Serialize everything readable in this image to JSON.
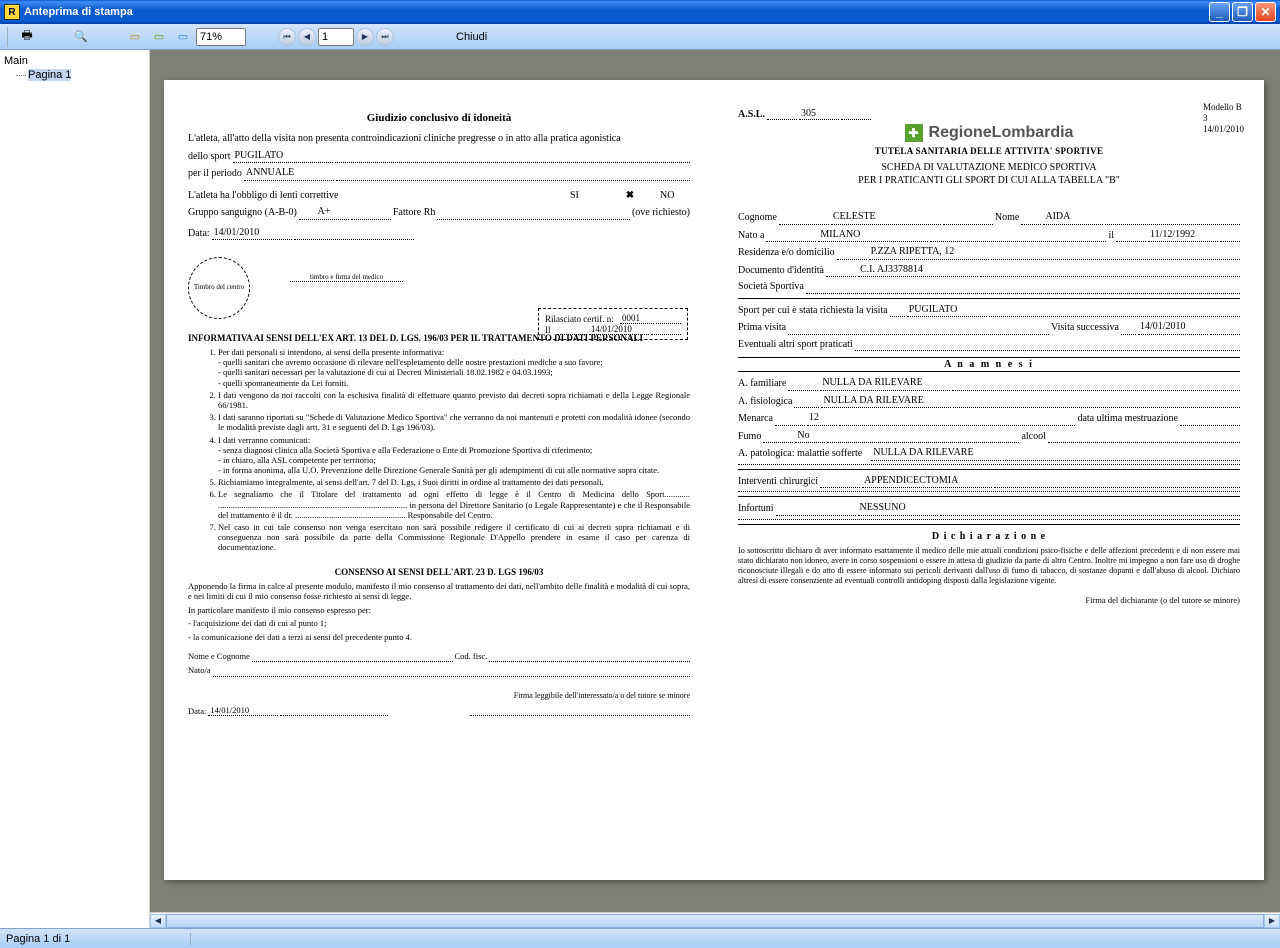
{
  "window": {
    "title": "Anteprima di stampa"
  },
  "toolbar": {
    "zoom": "71%",
    "page_current": "1",
    "close_label": "Chiudi"
  },
  "tree": {
    "root": "Main",
    "page": "Pagina 1"
  },
  "statusbar": {
    "page": "Pagina 1 di 1"
  },
  "left": {
    "title": "Giudizio conclusivo di idoneità",
    "intro": "L'atleta, all'atto della visita non presenta controindicazioni cliniche pregresse o in atto alla pratica agonistica",
    "sport_lbl": "dello sport",
    "sport": "PUGILATO",
    "periodo_lbl": "per il periodo",
    "periodo": "ANNUALE",
    "lenti": "L'atleta ha l'obbligo di lenti correttive",
    "si": "SI",
    "no": "NO",
    "gruppo_lbl": "Gruppo sanguigno (A-B-0)",
    "gruppo": "A+",
    "rh_lbl": "Fattore Rh",
    "rich": "(ove richiesto)",
    "data_lbl": "Data:",
    "data": "14/01/2010",
    "timbro": "Timbro del centro",
    "firmamed": "timbro e firma del medico",
    "cert_num_lbl": "Rilasciato certif. n:",
    "cert_num": "0001",
    "cert_il_lbl": "Il",
    "cert_il": "14/01/2010",
    "info_title": "INFORMATIVA AI SENSI DELL'EX ART. 13 DEL D. LGS. 196/03 PER IL TRATTAMENTO DI DATI PERSONALI",
    "p1": "Per dati personali si intendono, ai sensi della presente informativa:",
    "p1a": "quelli sanitari che avremo occasione di rilevare nell'espletamento delle nostre prestazioni mediche a suo favore;",
    "p1b": "quelli sanitari necessari per la valutazione di cui ai Decreti Ministeriali 18.02.1982 e 04.03.1993;",
    "p1c": "quelli spontaneamente da Lei forniti.",
    "p2": "I dati vengono da noi raccolti con la esclusiva finalità di effettuare quanto previsto dai decreti sopra richiamati e della Legge Regionale 66/1981.",
    "p3": "I dati saranno riportati su \"Schede di Valutazione Medico Sportiva\" che verranno da noi mantenuti e protetti con modalità idonee (secondo le modalità previste dagli artt. 31 e seguenti del D. Lgs 196/03).",
    "p4": "I dati verranno comunicati:",
    "p4a": "senza diagnosi clinica alla Società Sportiva e alla Federazione o Ente di Promozione Sportiva di riferimento;",
    "p4b": "in chiaro, alla ASL competente per territorio;",
    "p4c": "in forma anonima, alla U.O. Prevenzione delle Direzione Generale Sanità per gli adempimenti di cui alle normative sopra citate.",
    "p5": "Richiamiamo integralmente, ai sensi dell'art. 7 del D. Lgs, i Suoi diritti in ordine al trattamento dei dati personali.",
    "p6": "Le segnaliamo che il Titolare del trattamento ad ogni effetto di legge è il Centro di Medicina dello Sport............ ......................................................................................... in persona del Direttore Sanitario (o Legale Rappresentante) e che il Responsabile del trattamento è il dr. .................................................... Responsabile del Centro.",
    "p7": "Nel caso in cui tale consenso non venga esercitato non sarà possibile redigere il certificato di cui ai decreti sopra richiamati e di conseguenza non sarà possibile da parte della Commissione Regionale D'Appello prendere in esame il caso per carenza di documentazione.",
    "consenso_title": "CONSENSO AI SENSI DELL'ART. 23 D. LGS 196/03",
    "c1": "Apponendo la firma in calce al presente modulo, manifesto il mio consenso al trattamento dei dati, nell'ambito delle finalità e modalità di cui sopra, e nei limiti di cui il mio consenso fosse richiesto ai sensi di legge.",
    "c2": "In particolare manifesto il mio consenso espresso per:",
    "c2a": "- l'acquisizione dei dati di cui al punto 1;",
    "c2b": "- la comunicazione dei dati a terzi ai sensi del precedente punto 4.",
    "nomecog_lbl": "Nome e Cognome",
    "codfisc_lbl": "Cod. fisc.",
    "nato_lbl": "Nato/a",
    "firmaleg": "Firma leggibile dell'interessato/a o del tutore se minore",
    "data2": "14/01/2010"
  },
  "right": {
    "asl_lbl": "A.S.L.",
    "asl": "305",
    "brand": "RegioneLombardia",
    "modello_lbl": "Modello B",
    "modello_n": "3",
    "modello_d": "14/01/2010",
    "sub1": "TUTELA SANITARIA DELLE ATTIVITA' SPORTIVE",
    "sub2a": "SCHEDA DI VALUTAZIONE MEDICO SPORTIVA",
    "sub2b": "PER I PRATICANTI GLI SPORT DI CUI ALLA TABELLA \"B\"",
    "cognome_lbl": "Cognome",
    "cognome": "CELESTE",
    "nome_lbl": "Nome",
    "nome": "AIDA",
    "natoa_lbl": "Nato a",
    "natoa": "MILANO",
    "il_lbl": "il",
    "il": "11/12/1992",
    "res_lbl": "Residenza e/o domicilio",
    "res": "P.ZZA RIPETTA, 12",
    "doc_lbl": "Documento d'identità",
    "doc": "C.I. AJ3378814",
    "soc_lbl": "Società Sportiva",
    "sportreq_lbl": "Sport per cui è stata richiesta la visita",
    "sportreq": "PUGILATO",
    "prima_lbl": "Prima visita",
    "succ_lbl": "Visita successiva",
    "succ": "14/01/2010",
    "altri_lbl": "Eventuali altri sport praticati",
    "anamnesi": "A n a m n e s i",
    "afam_lbl": "A. familiare",
    "afam": "NULLA DA RILEVARE",
    "afis_lbl": "A. fisiologica",
    "afis": "NULLA DA RILEVARE",
    "menarca_lbl": "Menarca",
    "menarca": "12",
    "dum_lbl": "data ultima mestruazione",
    "fumo_lbl": "Fumo",
    "fumo": "No",
    "alcool_lbl": "alcool",
    "apat_lbl": "A. patologica: malattie sofferte",
    "apat": "NULLA DA RILEVARE",
    "interv_lbl": "Interventi chirurgici",
    "interv": "APPENDICECTOMIA",
    "infort_lbl": "Infortuni",
    "infort": "NESSUNO",
    "dich_title": "D i c h i a r a z i o n e",
    "dich": "Io sottoscritto dichiaro di aver informato esattamente il medico delle mie attuali condizioni psico-fisiche e delle affezioni precedenti e di non essere mai stato dichiarato non idoneo, avere in corso sospensioni o essere in attesa di giudizio da parte di altro Centro. Inoltre mi impegno a non fare uso di droghe riconosciute illegali e do atto di essere informato sui pericoli derivanti dall'uso di fumo di tabacco, di sostanze dopanti e dall'abuso di alcool. Dichiaro altresì di essere consenziente ad eventuali controlli antidoping disposti dalla legislazione vigente.",
    "firma_dich": "Firma del dichiarante (o del tutore se minore)"
  }
}
